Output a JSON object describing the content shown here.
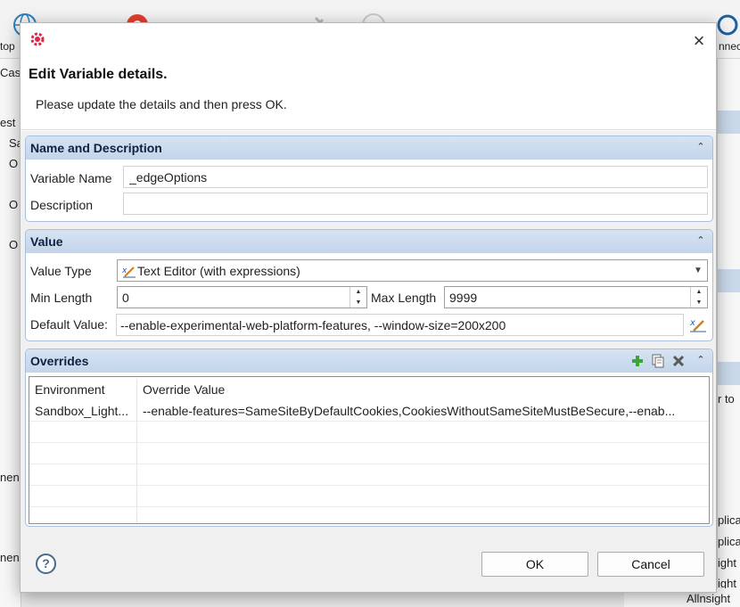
{
  "background": {
    "tb_label_left": "top",
    "tb_label_right": "nnec",
    "left_items": [
      "Cas",
      "est",
      "Sa",
      "O",
      "O",
      "O",
      "nen",
      "nen"
    ],
    "right_items": [
      "r to",
      "plica",
      "plica",
      "ight",
      "ight"
    ],
    "bottom_label": "Allnsight"
  },
  "dialog": {
    "title": "Edit Variable details.",
    "message": "Please update the details and then press OK."
  },
  "name_section": {
    "title": "Name and Description",
    "variable_name_label": "Variable Name",
    "variable_name_value": "_edgeOptions",
    "description_label": "Description",
    "description_value": ""
  },
  "value_section": {
    "title": "Value",
    "value_type_label": "Value Type",
    "value_type_selected": "Text Editor (with expressions)",
    "min_length_label": "Min Length",
    "min_length_value": "0",
    "max_length_label": "Max Length",
    "max_length_value": "9999",
    "default_value_label": "Default Value:",
    "default_value": "--enable-experimental-web-platform-features, --window-size=200x200"
  },
  "overrides_section": {
    "title": "Overrides",
    "columns": [
      "Environment",
      "Override Value"
    ],
    "rows": [
      {
        "environment": "Sandbox_Light...",
        "override": "--enable-features=SameSiteByDefaultCookies,CookiesWithoutSameSiteMustBeSecure,--enab..."
      }
    ]
  },
  "buttons": {
    "ok": "OK",
    "cancel": "Cancel"
  },
  "icons": {
    "close": "×",
    "help": "?",
    "collapse": "⌃"
  }
}
